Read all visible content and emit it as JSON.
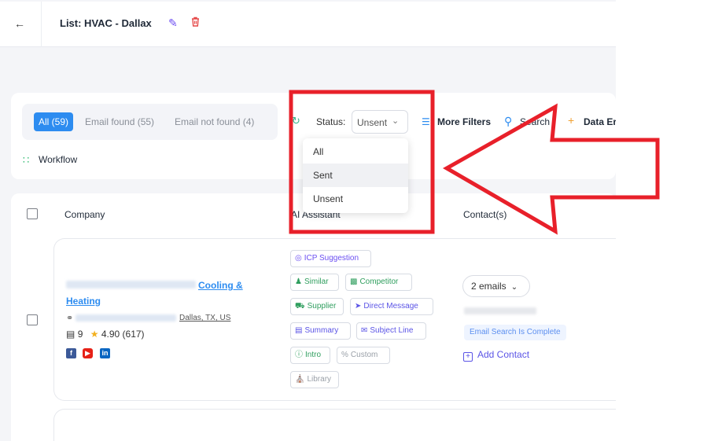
{
  "header": {
    "back_icon": "arrow-left-icon",
    "title": "List: HVAC - Dallax"
  },
  "tabs": [
    {
      "label": "All (59)",
      "active": true
    },
    {
      "label": "Email found (55)",
      "active": false
    },
    {
      "label": "Email not found (4)",
      "active": false
    }
  ],
  "toolbar": {
    "status_label": "Status:",
    "status_value": "Unsent",
    "more_filters": "More Filters",
    "search": "Search",
    "data_enrich": "Data Er",
    "workflow": "Workflow"
  },
  "status_dropdown": {
    "options": [
      "All",
      "Sent",
      "Unsent"
    ],
    "highlighted": "Sent"
  },
  "table": {
    "columns": [
      "Company",
      "AI Assistant",
      "Contact(s)"
    ],
    "row": {
      "company_name_visible": "Cooling &",
      "company_name_line2": "Heating",
      "address_visible": "Dallas, TX, US",
      "employees": "9",
      "rating": "4.90 (617)",
      "ai_chips": [
        "ICP Suggestion",
        "Similar",
        "Competitor",
        "Supplier",
        "Direct Message",
        "Summary",
        "Subject Line",
        "Intro",
        "Custom",
        "Library"
      ],
      "emails": "2 emails",
      "email_status": "Email Search Is Complete",
      "add_contact": "Add Contact"
    }
  },
  "colors": {
    "accent": "#2d8cf0",
    "purple": "#6b4ff2",
    "annotation": "#e8202a"
  }
}
